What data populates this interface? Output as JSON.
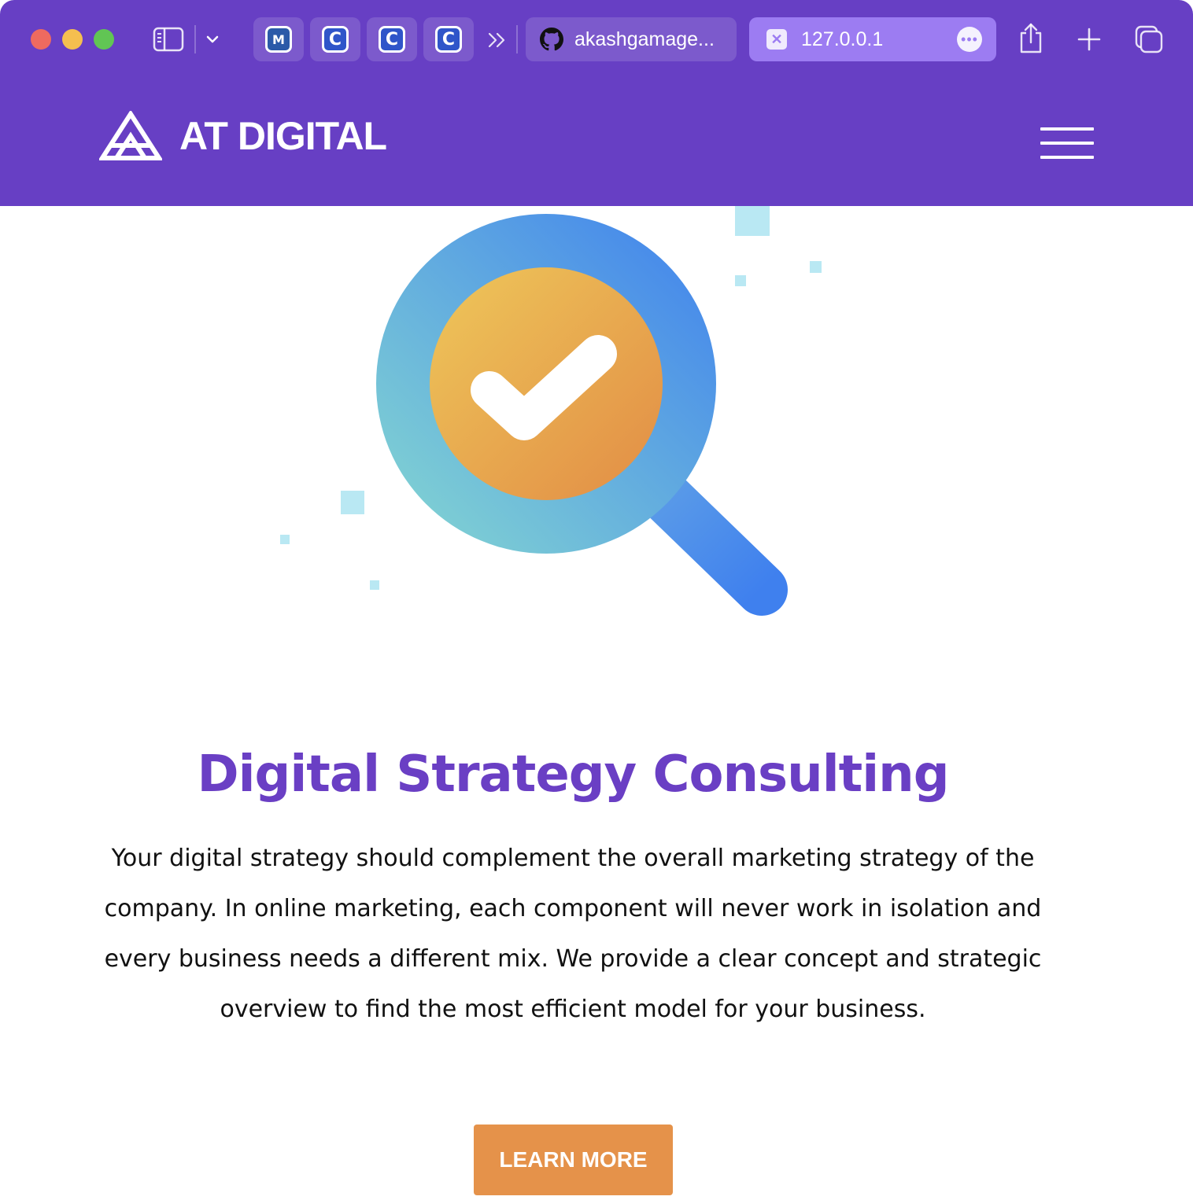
{
  "browser": {
    "pinned_tabs": [
      {
        "icon": "m-logo-icon",
        "glyph": "M"
      },
      {
        "icon": "c-logo-icon",
        "glyph": "C"
      },
      {
        "icon": "c-logo-icon",
        "glyph": "C"
      },
      {
        "icon": "c-logo-icon",
        "glyph": "C"
      }
    ],
    "tabs": [
      {
        "label": "akashgamage...",
        "icon": "github-icon",
        "active": false
      },
      {
        "label": "127.0.0.1",
        "icon": "close-tab-icon",
        "active": true
      }
    ],
    "chrome_color": "#673fc4",
    "active_tab_color": "#9c7cf2"
  },
  "site": {
    "brand": "AT DIGITAL",
    "header_color": "#673fc4",
    "menu_icon": "hamburger-menu-icon"
  },
  "hero": {
    "illustration": "magnifier-checkmark-icon",
    "title": "Digital Strategy Consulting",
    "description": "Your digital strategy should complement the overall marketing strategy of the company. In online marketing, each component will never work in isolation and every business needs a different mix. We provide a clear concept and strategic overview to find the most efficient model for your business.",
    "cta_label": "LEARN MORE",
    "title_color": "#6a3fc4",
    "cta_color": "#e5924a"
  }
}
